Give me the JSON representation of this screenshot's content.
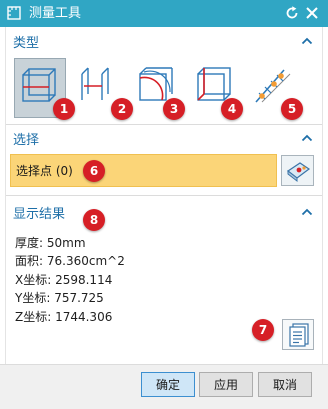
{
  "window": {
    "title": "测量工具"
  },
  "sections": {
    "type": {
      "label": "类型"
    },
    "select": {
      "label": "选择",
      "selection_text": "选择点 (0)"
    },
    "results": {
      "label": "显示结果"
    }
  },
  "type_options": [
    {
      "icon": "measure-thickness-icon",
      "selected": true
    },
    {
      "icon": "measure-distance-icon",
      "selected": false
    },
    {
      "icon": "measure-arc-icon",
      "selected": false
    },
    {
      "icon": "measure-box-icon",
      "selected": false
    },
    {
      "icon": "measure-points-icon",
      "selected": false
    }
  ],
  "badges": [
    "1",
    "2",
    "3",
    "4",
    "5",
    "6",
    "7",
    "8"
  ],
  "results": [
    "厚度:  50mm",
    "面积:  76.360cm^2",
    "X坐标:  2598.114",
    "Y坐标:  757.725",
    "Z坐标:  1744.306"
  ],
  "buttons": {
    "ok": "确定",
    "apply": "应用",
    "cancel": "取消"
  },
  "colors": {
    "titlebar": "#30a6c4",
    "section_label": "#1e6fa8",
    "selection_bar": "#fbd578",
    "badge": "#d61f26",
    "ok_button": "#cfe6f7"
  }
}
